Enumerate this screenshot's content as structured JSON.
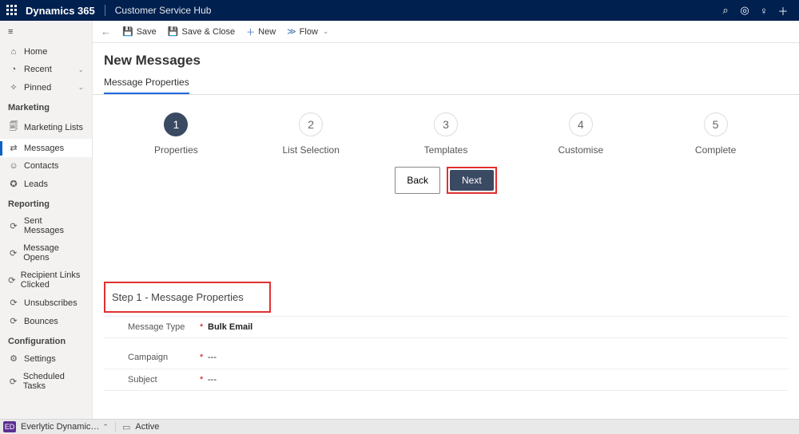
{
  "header": {
    "brand": "Dynamics 365",
    "area": "Customer Service Hub"
  },
  "sidebar": {
    "top": [
      {
        "icon": "⌂",
        "label": "Home",
        "chev": false
      },
      {
        "icon": "◔",
        "label": "Recent",
        "chev": true
      },
      {
        "icon": "✧",
        "label": "Pinned",
        "chev": true
      }
    ],
    "groups": [
      {
        "title": "Marketing",
        "items": [
          {
            "icon": "🗐",
            "label": "Marketing Lists"
          },
          {
            "icon": "⇄",
            "label": "Messages",
            "active": true
          },
          {
            "icon": "☺",
            "label": "Contacts"
          },
          {
            "icon": "✪",
            "label": "Leads"
          }
        ]
      },
      {
        "title": "Reporting",
        "items": [
          {
            "icon": "⟳",
            "label": "Sent Messages"
          },
          {
            "icon": "⟳",
            "label": "Message Opens"
          },
          {
            "icon": "⟳",
            "label": "Recipient Links Clicked"
          },
          {
            "icon": "⟳",
            "label": "Unsubscribes"
          },
          {
            "icon": "⟳",
            "label": "Bounces"
          }
        ]
      },
      {
        "title": "Configuration",
        "items": [
          {
            "icon": "⚙",
            "label": "Settings"
          },
          {
            "icon": "⟳",
            "label": "Scheduled Tasks"
          }
        ]
      }
    ]
  },
  "commandbar": {
    "save": "Save",
    "saveClose": "Save & Close",
    "new": "New",
    "flow": "Flow"
  },
  "page": {
    "title": "New Messages",
    "tab": "Message Properties"
  },
  "wizard": {
    "steps": [
      {
        "num": "1",
        "label": "Properties",
        "active": true
      },
      {
        "num": "2",
        "label": "List Selection"
      },
      {
        "num": "3",
        "label": "Templates"
      },
      {
        "num": "4",
        "label": "Customise"
      },
      {
        "num": "5",
        "label": "Complete"
      }
    ],
    "back": "Back",
    "next": "Next"
  },
  "section": {
    "title": "Step 1 - Message Properties",
    "rows": [
      {
        "label": "Message Type",
        "value": "Bulk Email",
        "required": true
      },
      {
        "label": "Campaign",
        "value": "---",
        "required": true,
        "tall": true
      },
      {
        "label": "Subject",
        "value": "---",
        "required": true
      }
    ]
  },
  "footer": {
    "chip": "ED",
    "area": "Everlytic Dynamic…",
    "status": "Active"
  }
}
